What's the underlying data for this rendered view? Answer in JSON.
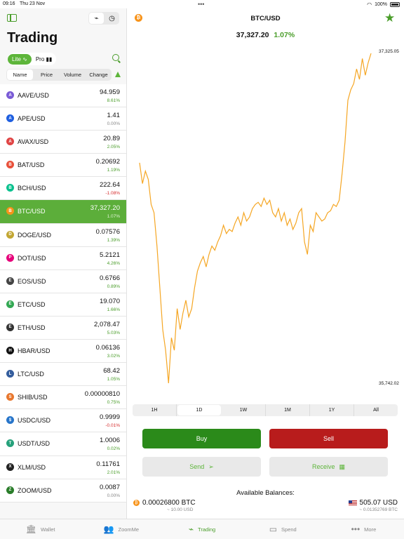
{
  "status": {
    "time": "09:16",
    "date": "Thu 23 Nov",
    "battery": "100%"
  },
  "sidebar": {
    "title": "Trading",
    "mode": {
      "lite": "Lite",
      "pro": "Pro"
    },
    "sort_tabs": [
      "Name",
      "Price",
      "Volume",
      "Change"
    ],
    "active_sort": "Name",
    "pairs": [
      {
        "name": "AAVE/USD",
        "price": "94.959",
        "change": "8.61%",
        "dir": "up",
        "color": "#7a5bd6",
        "glyph": "A"
      },
      {
        "name": "APE/USD",
        "price": "1.41",
        "change": "0.00%",
        "dir": "flat",
        "color": "#1f5fe0",
        "glyph": "A"
      },
      {
        "name": "AVAX/USD",
        "price": "20.89",
        "change": "2.05%",
        "dir": "up",
        "color": "#e04444",
        "glyph": "A"
      },
      {
        "name": "BAT/USD",
        "price": "0.20692",
        "change": "1.19%",
        "dir": "up",
        "color": "#e8503a",
        "glyph": "B"
      },
      {
        "name": "BCH/USD",
        "price": "222.64",
        "change": "-1.08%",
        "dir": "down",
        "color": "#0ac18e",
        "glyph": "B"
      },
      {
        "name": "BTC/USD",
        "price": "37,327.20",
        "change": "1.07%",
        "dir": "up",
        "color": "#f7931a",
        "glyph": "B",
        "selected": true
      },
      {
        "name": "DOGE/USD",
        "price": "0.07576",
        "change": "1.39%",
        "dir": "up",
        "color": "#c2a633",
        "glyph": "D"
      },
      {
        "name": "DOT/USD",
        "price": "5.2121",
        "change": "4.26%",
        "dir": "up",
        "color": "#e6007a",
        "glyph": "P"
      },
      {
        "name": "EOS/USD",
        "price": "0.6766",
        "change": "0.89%",
        "dir": "up",
        "color": "#444444",
        "glyph": "E"
      },
      {
        "name": "ETC/USD",
        "price": "19.070",
        "change": "1.66%",
        "dir": "up",
        "color": "#33a853",
        "glyph": "E"
      },
      {
        "name": "ETH/USD",
        "price": "2,078.47",
        "change": "5.03%",
        "dir": "up",
        "color": "#333333",
        "glyph": "E"
      },
      {
        "name": "HBAR/USD",
        "price": "0.06136",
        "change": "3.02%",
        "dir": "up",
        "color": "#111111",
        "glyph": "H"
      },
      {
        "name": "LTC/USD",
        "price": "68.42",
        "change": "1.05%",
        "dir": "up",
        "color": "#345d9d",
        "glyph": "L"
      },
      {
        "name": "SHIB/USD",
        "price": "0.00000810",
        "change": "0.75%",
        "dir": "up",
        "color": "#e8772e",
        "glyph": "S"
      },
      {
        "name": "USDC/USD",
        "price": "0.9999",
        "change": "-0.01%",
        "dir": "down",
        "color": "#2775ca",
        "glyph": "$"
      },
      {
        "name": "USDT/USD",
        "price": "1.0006",
        "change": "0.02%",
        "dir": "up",
        "color": "#26a17b",
        "glyph": "T"
      },
      {
        "name": "XLM/USD",
        "price": "0.11761",
        "change": "2.01%",
        "dir": "up",
        "color": "#222222",
        "glyph": "X"
      },
      {
        "name": "ZOOM/USD",
        "price": "0.0087",
        "change": "0.00%",
        "dir": "flat",
        "color": "#2a7d2a",
        "glyph": "Z"
      }
    ]
  },
  "main": {
    "pair_title": "BTC/USD",
    "price": "37,327.20",
    "change": "1.07%",
    "high_label": "37,325.05",
    "low_label": "35,742.02",
    "ranges": [
      "1H",
      "1D",
      "1W",
      "1M",
      "1Y",
      "All"
    ],
    "active_range": "1D",
    "buy_label": "Buy",
    "sell_label": "Sell",
    "send_label": "Send",
    "receive_label": "Receive",
    "available_label": "Available Balances:",
    "btc_balance": "0.00026800 BTC",
    "btc_balance_fiat": "~ 10.00 USD",
    "usd_balance": "505.07 USD",
    "usd_balance_btc": "~ 0.01352769 BTC",
    "line_color": "#f5a623"
  },
  "chart_data": {
    "type": "line",
    "title": "BTC/USD",
    "ylim": [
      35742.02,
      37325.05
    ],
    "values": [
      36800,
      36700,
      36760,
      36720,
      36600,
      36560,
      36400,
      36200,
      36000,
      35900,
      35742,
      35960,
      35900,
      36100,
      36000,
      36080,
      36140,
      36060,
      36100,
      36200,
      36280,
      36320,
      36350,
      36300,
      36360,
      36400,
      36380,
      36420,
      36450,
      36500,
      36460,
      36480,
      36470,
      36510,
      36540,
      36500,
      36560,
      36520,
      36540,
      36580,
      36600,
      36610,
      36590,
      36630,
      36600,
      36620,
      36560,
      36540,
      36580,
      36520,
      36560,
      36500,
      36530,
      36480,
      36510,
      36560,
      36580,
      36420,
      36360,
      36500,
      36470,
      36560,
      36540,
      36520,
      36530,
      36560,
      36570,
      36600,
      36590,
      36620,
      36750,
      36900,
      37100,
      37150,
      37180,
      37250,
      37200,
      37300,
      37220,
      37280,
      37325
    ]
  },
  "tabbar": {
    "items": [
      {
        "label": "Wallet",
        "icon": "bank-icon"
      },
      {
        "label": "ZoomMe",
        "icon": "people-icon"
      },
      {
        "label": "Trading",
        "icon": "pulse-icon",
        "active": true
      },
      {
        "label": "Spend",
        "icon": "card-icon"
      },
      {
        "label": "More",
        "icon": "ellipsis-icon"
      }
    ]
  }
}
